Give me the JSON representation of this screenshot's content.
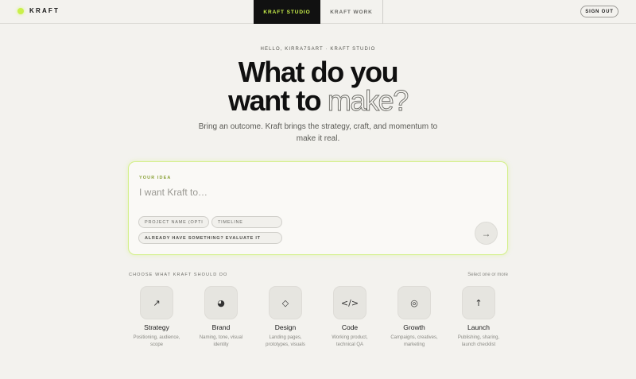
{
  "brand": {
    "logo_text": "KRAFT",
    "accent": "#c9f04a"
  },
  "nav": {
    "tabs": [
      {
        "label": "KRAFT STUDIO",
        "active": true
      },
      {
        "label": "KRAFT WORK",
        "active": false
      }
    ],
    "sign_out": "SIGN OUT"
  },
  "hero": {
    "greeting": "HELLO, KIRRA7SART · KRAFT STUDIO",
    "title_line1": "What do you",
    "title_line2_plain": "want to ",
    "title_line2_outline": "make?",
    "subtitle": "Bring an outcome. Kraft brings the strategy, craft, and momentum to make it real."
  },
  "idea": {
    "label": "YOUR IDEA",
    "placeholder": "I want Kraft to…",
    "project_name_placeholder": "PROJECT NAME (OPTIONAL)",
    "timeline_placeholder": "TIMELINE",
    "evaluate_label": "ALREADY HAVE SOMETHING? EVALUATE IT",
    "submit_icon": "→"
  },
  "options": {
    "label": "CHOOSE WHAT KRAFT SHOULD DO",
    "hint": "Select one or more",
    "items": [
      {
        "icon": "↗",
        "icon_name": "arrow-up-right-icon",
        "title": "Strategy",
        "desc": "Positioning, audience, scope"
      },
      {
        "icon": "◕",
        "icon_name": "half-circle-icon",
        "title": "Brand",
        "desc": "Naming, tone, visual identity"
      },
      {
        "icon": "◇",
        "icon_name": "diamond-icon",
        "title": "Design",
        "desc": "Landing pages, prototypes, visuals"
      },
      {
        "icon": "</>",
        "icon_name": "code-icon",
        "title": "Code",
        "desc": "Working product, technical QA"
      },
      {
        "icon": "◎",
        "icon_name": "target-icon",
        "title": "Growth",
        "desc": "Campaigns, creatives, marketing"
      },
      {
        "icon": "↑",
        "icon_name": "arrow-up-icon",
        "title": "Launch",
        "desc": "Publishing, sharing, launch checklist"
      }
    ]
  }
}
